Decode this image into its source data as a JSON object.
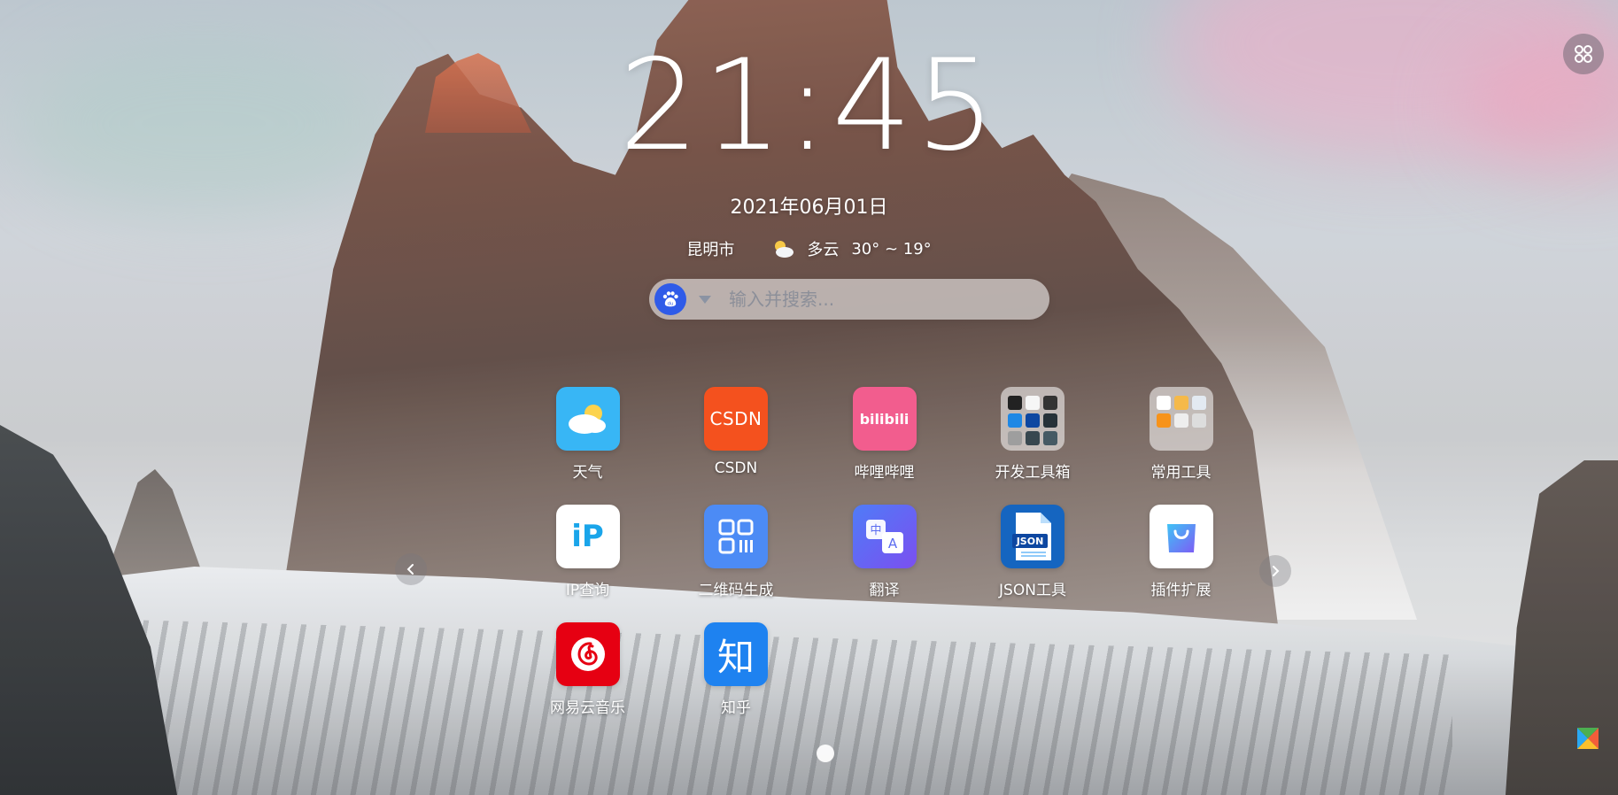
{
  "clock": {
    "time": "21:45"
  },
  "date": {
    "text": "2021年06月01日"
  },
  "weather": {
    "city": "昆明市",
    "icon": "partly-cloudy-icon",
    "condition": "多云",
    "temperature": "30° ~ 19°"
  },
  "search": {
    "engine_icon": "baidu-icon",
    "placeholder": "输入并搜索..."
  },
  "apps": [
    {
      "label": "天气",
      "icon": "weather-icon",
      "color": "#38b6f5"
    },
    {
      "label": "CSDN",
      "icon": "csdn-icon",
      "color": "#f4511e"
    },
    {
      "label": "哔哩哔哩",
      "icon": "bilibili-icon",
      "color": "#f25d8e"
    },
    {
      "label": "开发工具箱",
      "icon": "folder-icon",
      "color": "#ffffff"
    },
    {
      "label": "常用工具",
      "icon": "folder-icon",
      "color": "#ffffff"
    },
    {
      "label": "IP查询",
      "icon": "ip-icon",
      "color": "#ffffff"
    },
    {
      "label": "二维码生成",
      "icon": "qrcode-icon",
      "color": "#4c8bf5"
    },
    {
      "label": "翻译",
      "icon": "translate-icon",
      "color": "#5b6cf0"
    },
    {
      "label": "JSON工具",
      "icon": "json-icon",
      "color": "#1565c0"
    },
    {
      "label": "插件扩展",
      "icon": "shopping-bag-icon",
      "color": "#ffffff"
    },
    {
      "label": "网易云音乐",
      "icon": "netease-music-icon",
      "color": "#e60012"
    },
    {
      "label": "知乎",
      "icon": "zhihu-icon",
      "color": "#1e82f0"
    }
  ],
  "icon_text": {
    "csdn": "CSDN",
    "bilibili": "bilibili",
    "ip": "iP",
    "json": "JSON",
    "translate_zh": "中",
    "translate_en": "A",
    "zhihu": "知",
    "baidu": "du"
  },
  "controls": {
    "menu_icon": "grid-menu-icon",
    "prev_icon": "chevron-left-icon",
    "next_icon": "chevron-right-icon"
  }
}
